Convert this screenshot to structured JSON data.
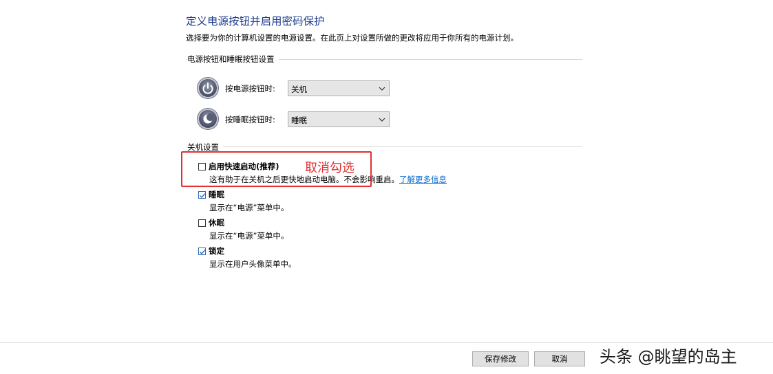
{
  "header": {
    "title": "定义电源按钮并启用密码保护",
    "description": "选择要为你的计算机设置的电源设置。在此页上对设置所做的更改将应用于你所有的电源计划。"
  },
  "power_buttons_section": {
    "heading": "电源按钮和睡眠按钮设置",
    "power_button": {
      "label": "按电源按钮时:",
      "value": "关机",
      "icon": "power-icon"
    },
    "sleep_button": {
      "label": "按睡眠按钮时:",
      "value": "睡眠",
      "icon": "sleep-moon-icon"
    }
  },
  "shutdown_section": {
    "heading": "关机设置",
    "options": [
      {
        "label": "启用快速启动(推荐)",
        "checked": false,
        "description": "这有助于在关机之后更快地启动电脑。不会影响重启。",
        "link": "了解更多信息"
      },
      {
        "label": "睡眠",
        "checked": true,
        "description": "显示在“电源”菜单中。"
      },
      {
        "label": "休眠",
        "checked": false,
        "description": "显示在“电源”菜单中。"
      },
      {
        "label": "锁定",
        "checked": true,
        "description": "显示在用户头像菜单中。"
      }
    ]
  },
  "annotation": {
    "text": "取消勾选",
    "color": "#e03030"
  },
  "footer": {
    "save_label": "保存修改",
    "cancel_label": "取消"
  },
  "watermark": {
    "text": "头条 @眺望的岛主"
  },
  "colors": {
    "title": "#1e3d8f",
    "link": "#0066cc",
    "checkbox_check": "#2f6db5"
  }
}
